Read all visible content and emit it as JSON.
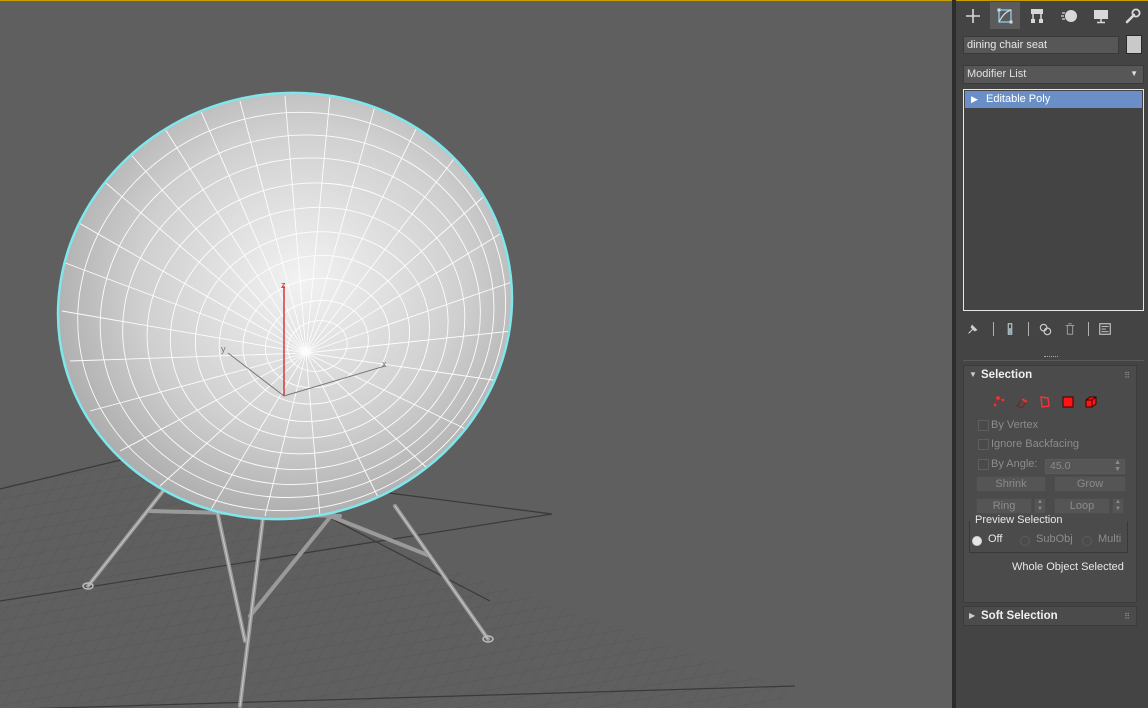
{
  "command_panel": {
    "tabs": [
      {
        "name": "create",
        "icon": "plus-icon"
      },
      {
        "name": "modify",
        "icon": "modify-icon"
      },
      {
        "name": "hierarchy",
        "icon": "hierarchy-icon"
      },
      {
        "name": "motion",
        "icon": "motion-icon"
      },
      {
        "name": "display",
        "icon": "display-icon"
      },
      {
        "name": "utilities",
        "icon": "wrench-icon"
      }
    ],
    "active_tab": "modify",
    "object_name": "dining chair seat",
    "object_color": "#c9c9c9",
    "modifier_list_label": "Modifier List",
    "modifier_stack": [
      {
        "label": "Editable Poly",
        "selected": true
      }
    ]
  },
  "selection_rollout": {
    "title": "Selection",
    "sub_levels": [
      "vertex",
      "edge",
      "border",
      "polygon",
      "element"
    ],
    "by_vertex_label": "By Vertex",
    "ignore_backfacing_label": "Ignore Backfacing",
    "by_angle_label": "By Angle:",
    "by_angle_value": "45.0",
    "shrink_label": "Shrink",
    "grow_label": "Grow",
    "ring_label": "Ring",
    "loop_label": "Loop",
    "preview_selection_label": "Preview Selection",
    "preview_options": [
      {
        "label": "Off",
        "selected": true
      },
      {
        "label": "SubObj",
        "selected": false
      },
      {
        "label": "Multi",
        "selected": false
      }
    ],
    "status": "Whole Object Selected"
  },
  "soft_selection_rollout": {
    "title": "Soft Selection"
  },
  "viewport": {
    "gizmo_axes": {
      "x": "x",
      "y": "y",
      "z": "z"
    },
    "selection_color": "#7fe6ec"
  }
}
